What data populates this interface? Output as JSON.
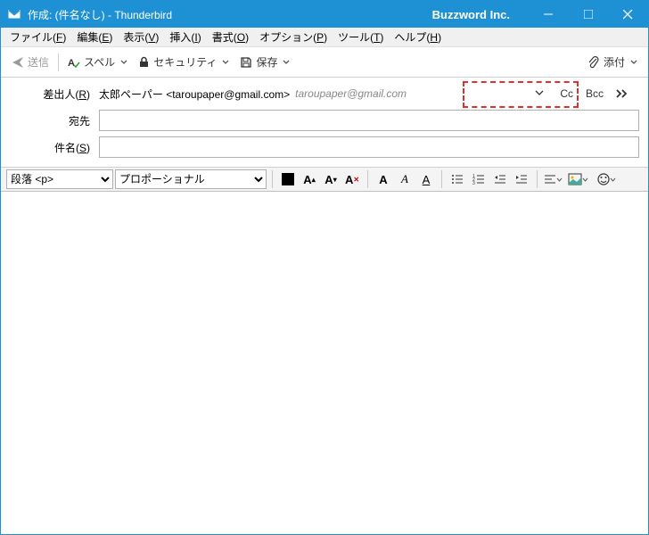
{
  "titlebar": {
    "title": "作成: (件名なし) - Thunderbird",
    "company": "Buzzword Inc."
  },
  "menubar": {
    "file": "ファイル(F)",
    "edit": "編集(E)",
    "view": "表示(V)",
    "insert": "挿入(I)",
    "format": "書式(O)",
    "options": "オプション(P)",
    "tools": "ツール(T)",
    "help": "ヘルプ(H)"
  },
  "toolbar": {
    "send": "送信",
    "spell": "スペル",
    "security": "セキュリティ",
    "save": "保存",
    "attach": "添付"
  },
  "address": {
    "from_label": "差出人(R)",
    "from_name": "太郎ペーパー <taroupaper@gmail.com>",
    "from_email_gray": "taroupaper@gmail.com",
    "to_label": "宛先",
    "to_value": "",
    "subject_label": "件名(S)",
    "subject_value": "",
    "cc": "Cc",
    "bcc": "Bcc"
  },
  "formatbar": {
    "paragraph": "段落 <p>",
    "font": "プロポーショナル"
  }
}
